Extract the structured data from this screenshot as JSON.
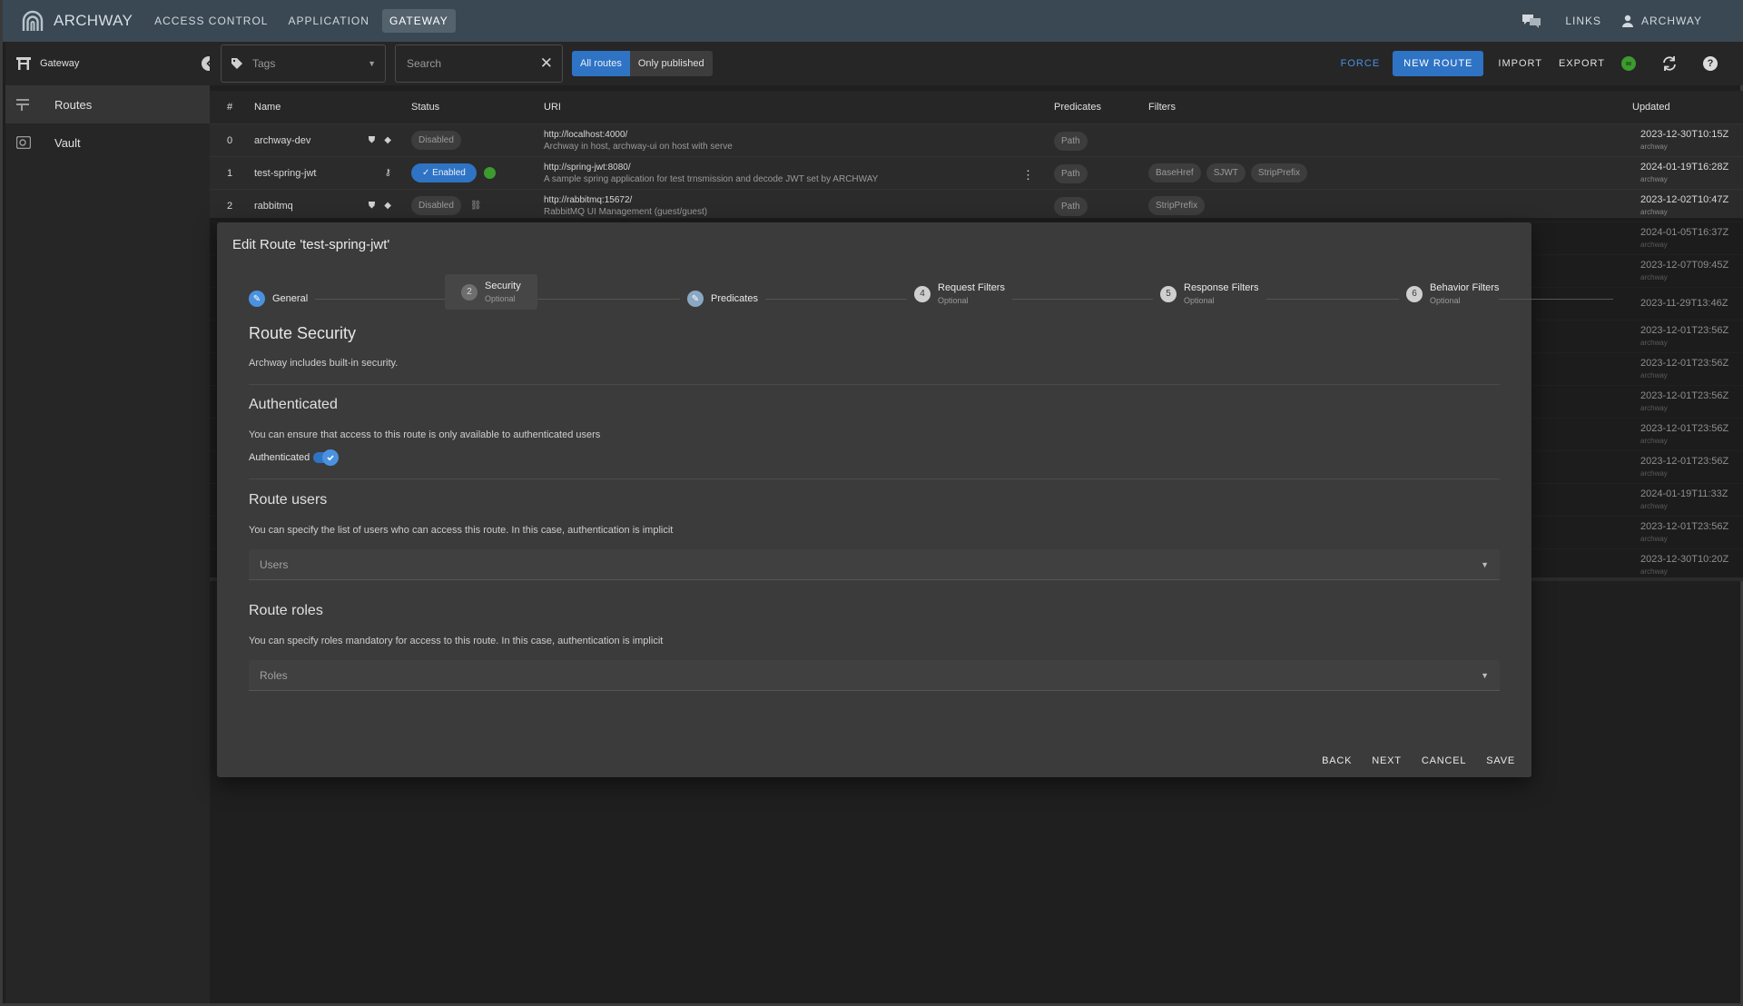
{
  "topbar": {
    "logo_text": "ARCHWAY",
    "nav": [
      "ACCESS CONTROL",
      "APPLICATION",
      "GATEWAY"
    ],
    "active_nav": "GATEWAY",
    "links": "LINKS",
    "user": "ARCHWAY"
  },
  "sidebar": {
    "header": "Gateway",
    "items": [
      {
        "label": "Routes",
        "icon": "routes-icon"
      },
      {
        "label": "Vault",
        "icon": "vault-icon"
      }
    ]
  },
  "toolbar": {
    "tags_placeholder": "Tags",
    "search_placeholder": "Search",
    "all_routes": "All routes",
    "only_published": "Only published",
    "force": "FORCE",
    "new_route": "NEW ROUTE",
    "import": "IMPORT",
    "export": "EXPORT"
  },
  "table": {
    "headers": {
      "num": "#",
      "name": "Name",
      "status": "Status",
      "uri": "URI",
      "predicates": "Predicates",
      "filters": "Filters",
      "updated": "Updated"
    },
    "rows": [
      {
        "num": "0",
        "name": "archway-dev",
        "status": "Disabled",
        "uri": "http://localhost:4000/",
        "desc": "Archway in host, archway-ui on host with serve",
        "predicates": "Path",
        "filters": []
      },
      {
        "num": "1",
        "name": "test-spring-jwt",
        "status": "Enabled",
        "uri": "http://spring-jwt:8080/",
        "desc": "A sample spring application for test trnsmission and decode JWT set by ARCHWAY",
        "predicates": "Path",
        "filters": [
          "BaseHref",
          "SJWT",
          "StripPrefix"
        ]
      },
      {
        "num": "2",
        "name": "rabbitmq",
        "status": "Disabled",
        "uri": "http://rabbitmq:15672/",
        "desc": "RabbitMQ UI Management (guest/guest)",
        "predicates": "Path",
        "filters": [
          "StripPrefix"
        ]
      }
    ],
    "updated": [
      {
        "date": "2023-12-30T10:15Z",
        "user": "archway"
      },
      {
        "date": "2024-01-19T16:28Z",
        "user": "archway"
      },
      {
        "date": "2023-12-02T10:47Z",
        "user": "archway"
      },
      {
        "date": "2024-01-05T16:37Z",
        "user": "archway"
      },
      {
        "date": "2023-12-07T09:45Z",
        "user": "archway"
      },
      {
        "date": "2023-11-29T13:46Z",
        "user": ""
      },
      {
        "date": "2023-12-01T23:56Z",
        "user": "archway"
      },
      {
        "date": "2023-12-01T23:56Z",
        "user": "archway"
      },
      {
        "date": "2023-12-01T23:56Z",
        "user": "archway"
      },
      {
        "date": "2023-12-01T23:56Z",
        "user": "archway"
      },
      {
        "date": "2023-12-01T23:56Z",
        "user": "archway"
      },
      {
        "date": "2024-01-19T11:33Z",
        "user": "archway"
      },
      {
        "date": "2023-12-01T23:56Z",
        "user": "archway"
      },
      {
        "date": "2023-12-30T10:20Z",
        "user": "archway"
      }
    ]
  },
  "modal": {
    "title": "Edit Route 'test-spring-jwt'",
    "steps": [
      {
        "label": "General",
        "sub": "",
        "icon": "pencil-icon"
      },
      {
        "label": "Security",
        "sub": "Optional",
        "num": "2"
      },
      {
        "label": "Predicates",
        "sub": "",
        "icon": "pencil-icon"
      },
      {
        "label": "Request Filters",
        "sub": "Optional",
        "num": "4"
      },
      {
        "label": "Response Filters",
        "sub": "Optional",
        "num": "5"
      },
      {
        "label": "Behavior Filters",
        "sub": "Optional",
        "num": "6"
      }
    ],
    "heading": "Route Security",
    "intro": "Archway includes built-in security.",
    "auth_title": "Authenticated",
    "auth_text": "You can ensure that access to this route is only available to authenticated users",
    "auth_switch_label": "Authenticated",
    "auth_switch_on": true,
    "users_title": "Route users",
    "users_text": "You can specify the list of users who can access this route. In this case, authentication is implicit",
    "users_placeholder": "Users",
    "roles_title": "Route roles",
    "roles_text": "You can specify roles mandatory for access to this route. In this case, authentication is implicit",
    "roles_placeholder": "Roles",
    "actions": {
      "back": "BACK",
      "next": "NEXT",
      "cancel": "CANCEL",
      "save": "SAVE"
    }
  },
  "colors": {
    "accent": "#2f73c4",
    "topbar": "#3a4853",
    "status_ok": "#3c9a2f"
  }
}
